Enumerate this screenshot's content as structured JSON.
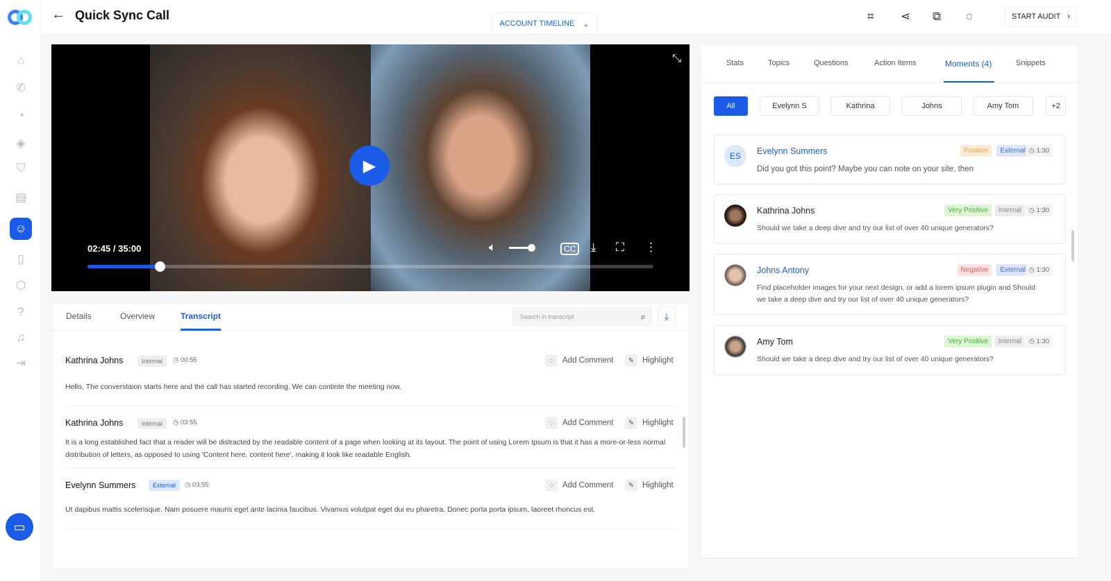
{
  "header": {
    "title": "Quick Sync Call",
    "account_timeline": "ACCOUNT TIMELINE",
    "start_audit": "START AUDIT"
  },
  "video": {
    "current_time": "02:45 / 35:00",
    "progress": 0.128,
    "volume": 0.8
  },
  "transcript_panel": {
    "tabs": [
      "Details",
      "Overview",
      "Transcript"
    ],
    "active_tab": "Transcript",
    "search_placeholder": "Search in transcript",
    "add_comment": "Add Comment",
    "highlight": "Highlight",
    "entries": [
      {
        "speaker": "Kathrina Johns",
        "badge": "Internal",
        "time": "00:55",
        "text": "Hello, The converstaion starts here and the call has started recording. We can continte the meeting now."
      },
      {
        "speaker": "Kathrina Johns",
        "badge": "Internal",
        "time": "03:55",
        "text": "It is a long established fact that a reader will be distracted by the readable content of a page when looking at its layout. The point of using Lorem Ipsum is that it has a more-or-less normal distribution of letters, as opposed to using 'Content here, content here', making it look like readable English."
      },
      {
        "speaker": "Evelynn Summers",
        "badge": "External",
        "time": "03:55",
        "text": "Ut dapibus mattis scelerisque. Nam posuere mauris eget ante lacinia faucibus. Vivamus volutpat eget dui eu pharetra. Donec porta porta ipsum, laoreet rhoncus est."
      }
    ]
  },
  "right_panel": {
    "tabs": [
      "Stats",
      "Topics",
      "Questions",
      "Action Items",
      "Moments (4)",
      "Snippets"
    ],
    "active_tab": "Moments (4)",
    "filters": [
      "All",
      "Evelynn S",
      "Kathrina",
      "Johns",
      "Amy Tom",
      "+2"
    ],
    "moments": [
      {
        "initials": "ES",
        "name": "Evelynn Summers",
        "sentiment": "Positive",
        "type": "External",
        "time": "1:30",
        "text": "Did you got this point? Maybe you can note on your site, then"
      },
      {
        "name": "Kathrina Johns",
        "sentiment": "Very Positive",
        "type": "Internal",
        "time": "1:30",
        "text": "Should we take a deep dive and try our list of over 40 unique generators?"
      },
      {
        "name": "Johns Antony",
        "sentiment": "Negative",
        "type": "External",
        "time": "1:30",
        "text": "Find placeholder images for your next design, or add a lorem ipsum plugin and Should we take a deep dive and try our list of over 40 unique generators?"
      },
      {
        "name": "Amy Tom",
        "sentiment": "Very Positive",
        "type": "Internal",
        "time": "1:30",
        "text": "Should we take a deep dive and try our list of over 40 unique generators?"
      }
    ]
  },
  "colors": {
    "accent": "#1a5ce8"
  }
}
